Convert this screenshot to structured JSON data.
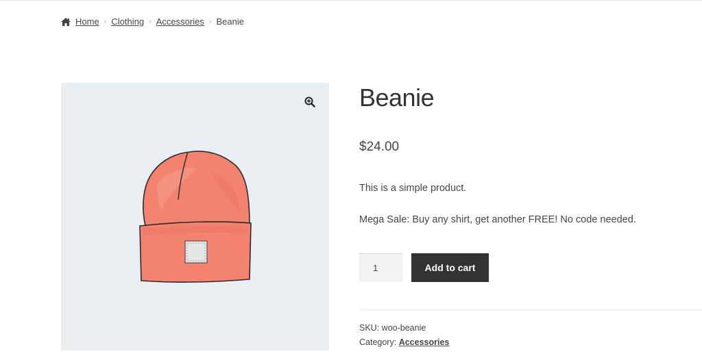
{
  "breadcrumb": {
    "home_icon": "home-icon",
    "items": [
      {
        "label": "Home"
      },
      {
        "label": "Clothing"
      },
      {
        "label": "Accessories"
      }
    ],
    "current": "Beanie",
    "separator": "›"
  },
  "gallery": {
    "zoom_icon": "zoom-in-icon",
    "image_subject": "beanie-illustration",
    "background": "#e9eef2",
    "hat_color": "#f3826f"
  },
  "product": {
    "title": "Beanie",
    "price": "$24.00",
    "short_description": "This is a simple product.",
    "sale_note": "Mega Sale: Buy any shirt, get another FREE! No code needed.",
    "quantity": "1",
    "add_to_cart_label": "Add to cart"
  },
  "meta": {
    "sku_label": "SKU:",
    "sku_value": "woo-beanie",
    "category_label": "Category:",
    "category_value": "Accessories"
  },
  "colors": {
    "button_bg": "#333333",
    "text": "#43454b"
  }
}
